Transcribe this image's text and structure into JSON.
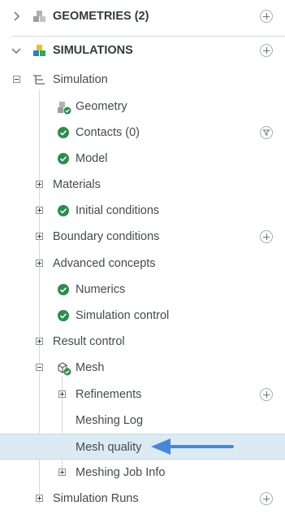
{
  "tree": {
    "geometries": {
      "label": "GEOMETRIES (2)",
      "icon": "geometries-cubes-icon"
    },
    "simulations": {
      "label": "SIMULATIONS",
      "icon": "simulations-cubes-icon"
    },
    "nodes": [
      {
        "label": "Simulation",
        "icon": "simulation-tree-icon"
      },
      {
        "label": "Geometry",
        "icon": "geometry-check-icon"
      },
      {
        "label": "Contacts (0)",
        "icon": "check-circle-icon"
      },
      {
        "label": "Model",
        "icon": "check-circle-icon"
      },
      {
        "label": "Materials"
      },
      {
        "label": "Initial conditions",
        "icon": "check-circle-icon"
      },
      {
        "label": "Boundary conditions"
      },
      {
        "label": "Advanced concepts"
      },
      {
        "label": "Numerics",
        "icon": "check-circle-icon"
      },
      {
        "label": "Simulation control",
        "icon": "check-circle-icon"
      },
      {
        "label": "Result control"
      },
      {
        "label": "Mesh",
        "icon": "mesh-check-icon"
      },
      {
        "label": "Refinements"
      },
      {
        "label": "Meshing Log"
      },
      {
        "label": "Mesh quality"
      },
      {
        "label": "Meshing Job Info"
      },
      {
        "label": "Simulation Runs"
      }
    ]
  },
  "colors": {
    "check": "#2e8b4d",
    "selection": "#dceaf4",
    "annotation_arrow": "#4a86d8"
  }
}
